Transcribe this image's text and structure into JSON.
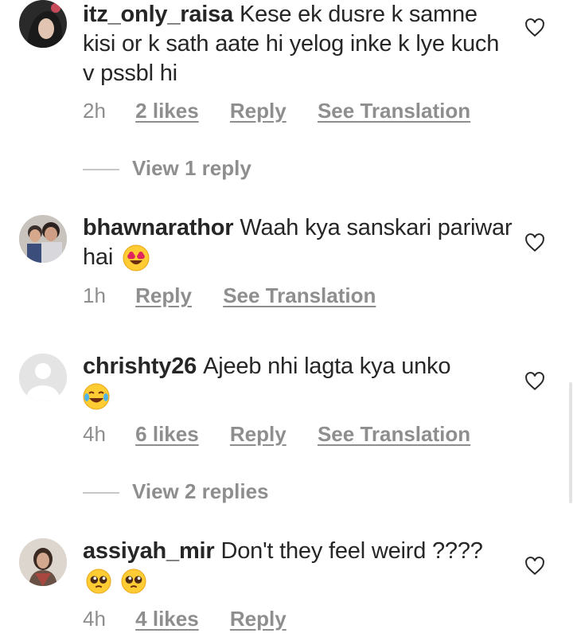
{
  "comments": [
    {
      "username": "itz_only_raisa",
      "text": "Kese ek dusre k samne kisi or k sath aate hi yelog inke k lye kuch v pssbl hi",
      "time": "2h",
      "likes": "2 likes",
      "reply": "Reply",
      "translate": "See Translation",
      "view_replies": "View 1 reply"
    },
    {
      "username": "bhawnarathor",
      "text": "Waah kya sanskari pariwar hai",
      "emoji": "smiling-face-with-heart-eyes",
      "time": "1h",
      "reply": "Reply",
      "translate": "See Translation"
    },
    {
      "username": "chrishty26",
      "text": "Ajeeb nhi lagta kya unko",
      "emoji": "face-with-tears-of-joy",
      "time": "4h",
      "likes": "6 likes",
      "reply": "Reply",
      "translate": "See Translation",
      "view_replies": "View 2 replies"
    },
    {
      "username": "assiyah_mir",
      "text": "Don't they feel weird ????",
      "emoji": "pleading-face x2",
      "time": "4h",
      "likes": "4 likes",
      "reply": "Reply"
    }
  ],
  "colors": {
    "text": "#262626",
    "secondary": "#8e8e8e",
    "divider": "#c7c7c7"
  }
}
